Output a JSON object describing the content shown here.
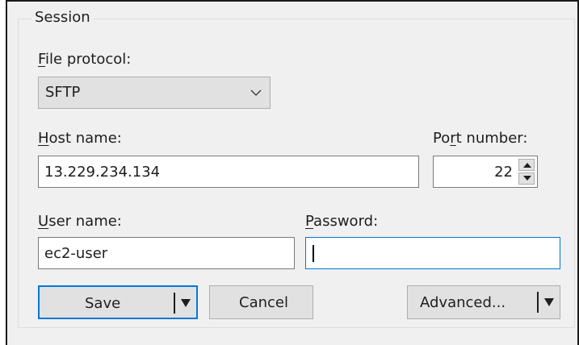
{
  "session": {
    "group_title": "Session",
    "file_protocol": {
      "label_mnemonic": "F",
      "label_rest": "ile protocol:",
      "value": "SFTP"
    },
    "host": {
      "label_mnemonic": "H",
      "label_rest": "ost name:",
      "value": "13.229.234.134"
    },
    "port": {
      "label_before": "Po",
      "label_mnemonic": "r",
      "label_rest": "t number:",
      "value": "22"
    },
    "user": {
      "label_mnemonic": "U",
      "label_rest": "ser name:",
      "value": "ec2-user"
    },
    "password": {
      "label_mnemonic": "P",
      "label_rest": "assword:",
      "value": ""
    }
  },
  "buttons": {
    "save": "Save",
    "cancel": "Cancel",
    "advanced": "Advanced..."
  },
  "icons": {
    "combo_arrow": "chevron-down-icon",
    "split_arrow": "triangle-down-icon",
    "spin_up": "triangle-up-icon",
    "spin_down": "triangle-down-icon"
  },
  "colors": {
    "focus": "#0078d7",
    "button_face": "#e1e1e1",
    "window": "#f0f0f0"
  }
}
